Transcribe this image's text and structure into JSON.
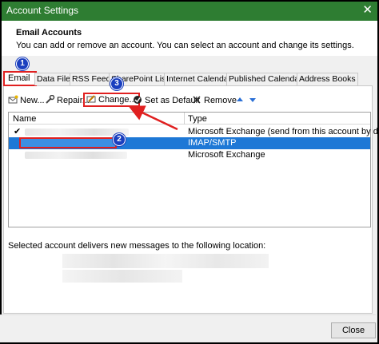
{
  "window": {
    "title": "Account Settings"
  },
  "header": {
    "title": "Email Accounts",
    "description": "You can add or remove an account. You can select an account and change its settings."
  },
  "tabs": [
    {
      "label": "Email",
      "active": true
    },
    {
      "label": "Data Files"
    },
    {
      "label": "RSS Feeds"
    },
    {
      "label": "SharePoint Lists"
    },
    {
      "label": "Internet Calendars"
    },
    {
      "label": "Published Calendars"
    },
    {
      "label": "Address Books"
    }
  ],
  "toolbar": {
    "new_label": "New...",
    "repair_label": "Repair...",
    "change_label": "Change...",
    "set_default_label": "Set as Default",
    "remove_label": "Remove"
  },
  "list": {
    "columns": {
      "name": "Name",
      "type": "Type"
    },
    "rows": [
      {
        "type": "Microsoft Exchange (send from this account by defa..."
      },
      {
        "type": "IMAP/SMTP"
      },
      {
        "type": "Microsoft Exchange"
      }
    ]
  },
  "deliver_text": "Selected account delivers new messages to the following location:",
  "buttons": {
    "close_label": "Close"
  },
  "badges": [
    "1",
    "2",
    "3"
  ],
  "colors": {
    "titlebar": "#2e7d32",
    "selection": "#1e78d6",
    "annotation": "#e02020",
    "badge": "#1a3fbf"
  },
  "icons": [
    "close-icon",
    "new-account-icon",
    "repair-icon",
    "change-icon",
    "check-icon",
    "remove-icon",
    "arrow-up-icon",
    "arrow-down-icon"
  ]
}
